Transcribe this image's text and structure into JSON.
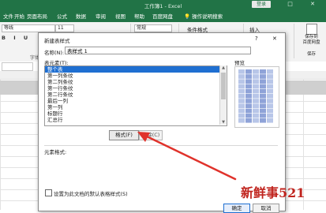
{
  "titlebar": {
    "title": "工作簿1 - Excel",
    "login": "登录",
    "window_controls": "–  □  ✕"
  },
  "ribbon_tabs": [
    "文件",
    "开始",
    "页面布局",
    "公式",
    "数据",
    "审阅",
    "视图",
    "帮助",
    "百度网盘"
  ],
  "search_tab": "操作说明搜索",
  "ribbon": {
    "font_name": "等线",
    "font_size": "11",
    "format_buttons": "B I U",
    "font_group": "字体",
    "number_format": "常规",
    "conditional_format": "条件格式",
    "insert": "插入",
    "save_group": {
      "line1": "保存到",
      "line2": "百度网盘",
      "label": "保存"
    }
  },
  "dialog": {
    "title": "新建表样式",
    "help": "?",
    "close": "✕",
    "name_label": "名称(N):",
    "name_value": "表样式 1",
    "elements_label": "表元素(T):",
    "elements": [
      "整个表",
      "第一列条纹",
      "第二列条纹",
      "第一行条纹",
      "第二行条纹",
      "最后一列",
      "第一列",
      "标题行",
      "汇总行"
    ],
    "selected_element": "整个表",
    "preview_label": "预览",
    "format_button": "格式(F)",
    "clear_button": "清除(C)",
    "element_format_label": "元素格式:",
    "default_checkbox_label": "设置为此文档的默认表格样式(S)",
    "ok_button": "确定",
    "cancel_button": "取消"
  },
  "watermark": "新鲜事521",
  "colors": {
    "excel_green": "#217346",
    "selection_blue": "#1f6fd1",
    "arrow_red": "#e0322b",
    "preview_blue": "#8fa3d8"
  }
}
